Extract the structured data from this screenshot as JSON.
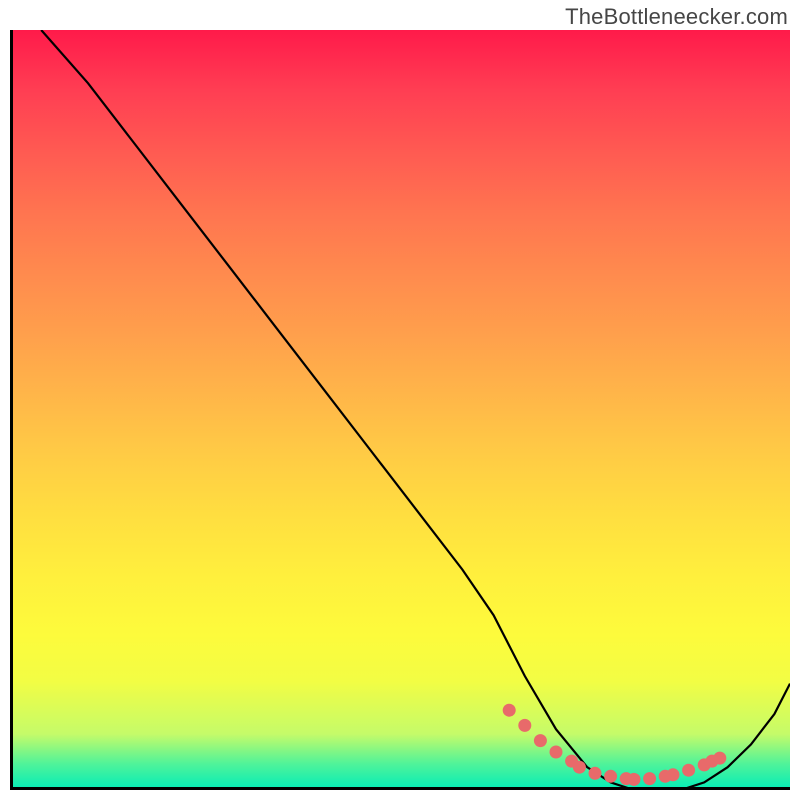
{
  "watermark": "TheBottleneecker.com",
  "chart_data": {
    "type": "line",
    "title": "",
    "xlabel": "",
    "ylabel": "",
    "xlim": [
      0,
      100
    ],
    "ylim": [
      0,
      100
    ],
    "series": [
      {
        "name": "curve",
        "x": [
          4,
          10,
          16,
          22,
          28,
          34,
          40,
          46,
          52,
          58,
          62,
          66,
          70,
          74,
          77,
          80,
          83,
          86,
          89,
          92,
          95,
          98,
          100
        ],
        "y": [
          100,
          93,
          85,
          77,
          69,
          61,
          53,
          45,
          37,
          29,
          23,
          15,
          8,
          3,
          1,
          0,
          0,
          0,
          1,
          3,
          6,
          10,
          14
        ]
      }
    ],
    "highlight_points": {
      "x": [
        64,
        66,
        68,
        70,
        72,
        73,
        75,
        77,
        79,
        80,
        82,
        84,
        85,
        87,
        89,
        90,
        91
      ],
      "y": [
        10.5,
        8.5,
        6.5,
        5,
        3.8,
        3,
        2.2,
        1.8,
        1.5,
        1.4,
        1.5,
        1.8,
        2,
        2.6,
        3.3,
        3.8,
        4.2
      ]
    },
    "background_gradient": {
      "top": "#ff1a4a",
      "mid": "#ffde40",
      "bottom": "#0bedb5"
    }
  }
}
